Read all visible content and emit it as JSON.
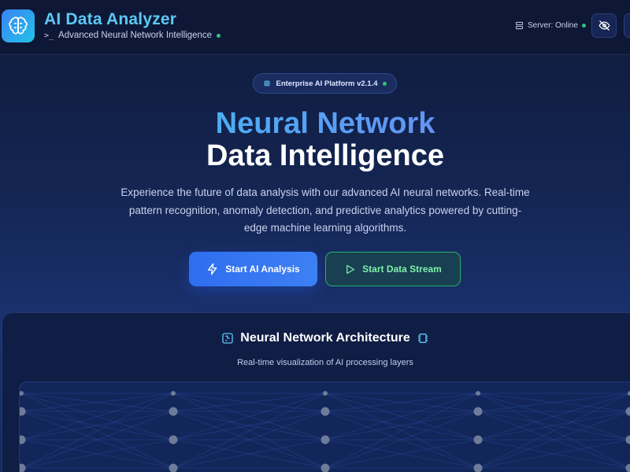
{
  "header": {
    "title": "AI Data Analyzer",
    "subtitle": "Advanced Neural Network Intelligence",
    "server_status": "Server: Online"
  },
  "badge": {
    "label": "Enterprise AI Platform v2.1.4"
  },
  "hero": {
    "title_line1": "Neural Network",
    "title_line2": "Data Intelligence",
    "description": "Experience the future of data analysis with our advanced AI neural networks. Real-time pattern recognition, anomaly detection, and predictive analytics powered by cutting-edge machine learning algorithms."
  },
  "actions": {
    "primary_label": "Start AI Analysis",
    "secondary_label": "Start Data Stream"
  },
  "panel": {
    "title": "Neural Network Architecture",
    "subtitle": "Real-time visualization of AI processing layers"
  },
  "colors": {
    "accent": "#38c6f0",
    "primary_button": "#2f6ef0",
    "success": "#34c07a",
    "background": "#142552"
  },
  "icons": {
    "logo": "brain-icon",
    "subtitle": "terminal-icon",
    "server": "server-icon",
    "toggle": "eye-off-icon",
    "badge": "chip-icon",
    "primary_button": "zap-icon",
    "secondary_button": "play-icon",
    "panel_title_left": "circuit-icon",
    "panel_title_right": "cpu-icon"
  }
}
